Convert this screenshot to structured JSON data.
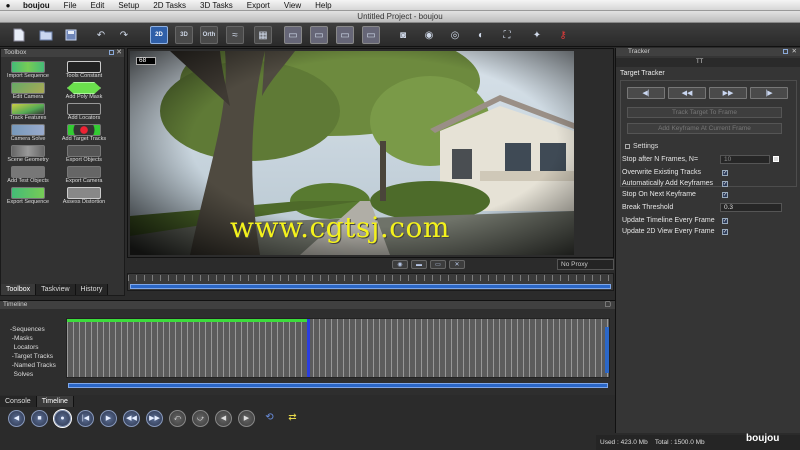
{
  "menubar": {
    "app": "boujou",
    "items": [
      "File",
      "Edit",
      "Setup",
      "2D Tasks",
      "3D Tasks",
      "Export",
      "View",
      "Help"
    ]
  },
  "window": {
    "title": "Untitled Project - boujou"
  },
  "toolbar": {
    "btn_2d": "2D",
    "btn_3d": "3D",
    "btn_orth": "Orth"
  },
  "toolbox": {
    "title": "Toolbox",
    "tools": [
      "Import Sequence",
      "Tools Constant",
      "Edit Camera",
      "Add Poly Mask",
      "Track Features",
      "Add Locators",
      "Camera Solve",
      "Add Target Tracks",
      "Scene Geometry",
      "Export Objects",
      "Add Test Objects",
      "Export Camera",
      "Export Sequence",
      "Assess Distortion"
    ],
    "tabs": [
      "Toolbox",
      "Taskview",
      "History"
    ],
    "active_tab": "Toolbox"
  },
  "viewer": {
    "frame_number": "68",
    "watermark": "www.cgtsj.com",
    "proxy": "No Proxy"
  },
  "tracker": {
    "panel_title": "Tracker",
    "subtab": "TT",
    "title": "Target Tracker",
    "btn_back_one": "◀|",
    "btn_back": "◀◀",
    "btn_fwd": "▶▶",
    "btn_fwd_one": "|▶",
    "wide_btn_1": "Track Target To Frame",
    "wide_btn_2": "Add Keyframe At Current Frame",
    "settings_label": "Settings",
    "stop_after_label": "Stop after N Frames, N=",
    "stop_after_value": "10",
    "overwrite_label": "Overwrite Existing Tracks",
    "auto_key_label": "Automatically Add Keyframes",
    "stop_next_label": "Stop On Next Keyframe",
    "break_label": "Break Threshold",
    "break_value": "0.3",
    "update_timeline_label": "Update Timeline Every Frame",
    "update_2d_label": "Update 2D View Every Frame"
  },
  "timeline": {
    "title": "Timeline",
    "tracks": [
      "Sequences",
      "Masks",
      "Locators",
      "Target Tracks",
      "Named Tracks",
      "Solves"
    ]
  },
  "bottom": {
    "tabs": [
      "Console",
      "Timeline"
    ],
    "active_tab": "Timeline",
    "used": "Used : 423.0 Mb",
    "total": "Total : 1500.0 Mb",
    "logo": "boujou"
  }
}
